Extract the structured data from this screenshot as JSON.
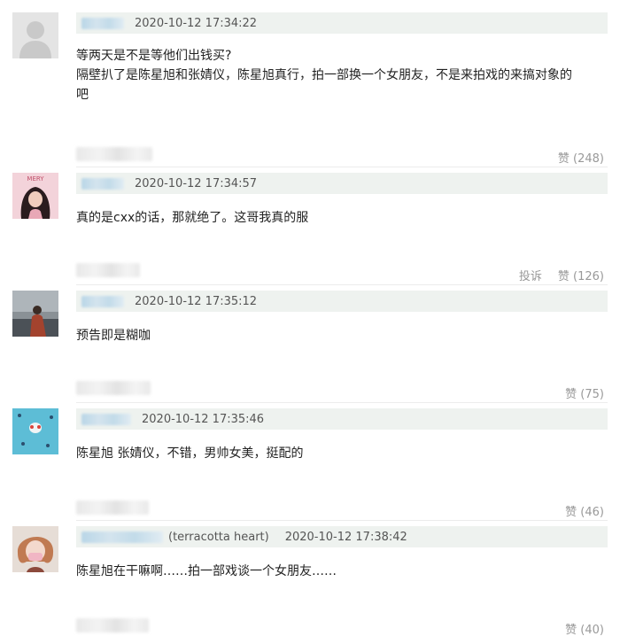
{
  "comments": [
    {
      "timestamp": "2020-10-12 17:34:22",
      "lines": [
        "等两天是不是等他们出钱买?",
        "隔壁扒了是陈星旭和张婧仪，陈星旭真行，拍一部换一个女朋友，不是来拍戏的来搞对象的",
        "吧"
      ],
      "like_label": "赞 (248)"
    },
    {
      "timestamp": "2020-10-12 17:34:57",
      "avatar_text": "MERY",
      "lines": [
        "真的是cxx的话，那就绝了。这哥我真的服"
      ],
      "report_label": "投诉",
      "like_label": "赞 (126)"
    },
    {
      "timestamp": "2020-10-12 17:35:12",
      "lines": [
        "预告即是糊咖"
      ],
      "like_label": "赞 (75)"
    },
    {
      "timestamp": "2020-10-12 17:35:46",
      "lines": [
        "陈星旭 张婧仪，不错，男帅女美，挺配的"
      ],
      "like_label": "赞 (46)"
    },
    {
      "timestamp": "2020-10-12 17:38:42",
      "username_suffix": "(terracotta heart)",
      "lines": [
        "陈星旭在干嘛啊……拍一部戏谈一个女朋友……"
      ],
      "like_label": "赞 (40)"
    }
  ]
}
